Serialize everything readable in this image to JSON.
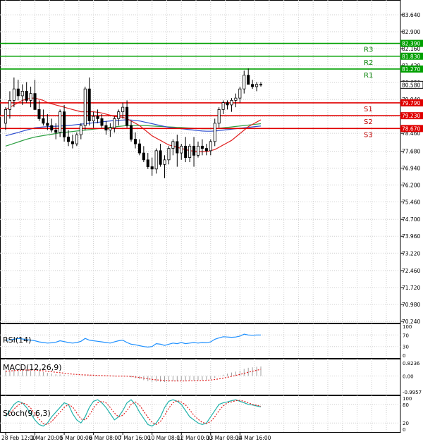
{
  "chart_data": {
    "type": "candlestick",
    "main": {
      "yticks": [
        "83.640",
        "82.900",
        "82.160",
        "81.420",
        "80.680",
        "79.940",
        "79.200",
        "78.460",
        "77.680",
        "76.940",
        "76.200",
        "75.460",
        "74.700",
        "73.960",
        "73.220",
        "72.460",
        "71.720",
        "70.980",
        "70.240"
      ],
      "ylim": [
        70.24,
        83.64
      ],
      "price": 80.58,
      "price_label": "80.580",
      "levels": [
        {
          "name": "R3",
          "value": 82.39,
          "label": "82.390",
          "color": "#00a000"
        },
        {
          "name": "R2",
          "value": 81.83,
          "label": "81.830",
          "color": "#00a000"
        },
        {
          "name": "R1",
          "value": 81.27,
          "label": "81.270",
          "color": "#00a000"
        },
        {
          "name": "S1",
          "value": 79.79,
          "label": "79.790",
          "color": "#e00000"
        },
        {
          "name": "S2",
          "value": 79.23,
          "label": "79.230",
          "color": "#e00000"
        },
        {
          "name": "S3",
          "value": 78.67,
          "label": "78.670",
          "color": "#e00000"
        }
      ],
      "candles": [
        [
          78.9,
          79.6,
          78.6,
          79.5
        ],
        [
          79.5,
          80.3,
          79.1,
          79.9
        ],
        [
          79.9,
          80.9,
          79.6,
          80.4
        ],
        [
          80.4,
          80.8,
          79.9,
          80.1
        ],
        [
          80.1,
          80.6,
          79.7,
          80.3
        ],
        [
          80.3,
          80.7,
          79.8,
          79.9
        ],
        [
          79.9,
          80.5,
          79.6,
          80.2
        ],
        [
          80.2,
          80.8,
          79.7,
          79.5
        ],
        [
          79.5,
          79.9,
          79.0,
          79.1
        ],
        [
          79.1,
          79.5,
          78.8,
          78.9
        ],
        [
          78.9,
          79.3,
          78.6,
          78.8
        ],
        [
          78.8,
          79.1,
          78.5,
          78.6
        ],
        [
          78.6,
          78.9,
          78.2,
          78.5
        ],
        [
          78.5,
          79.5,
          78.3,
          79.4
        ],
        [
          79.4,
          79.7,
          78.1,
          78.3
        ],
        [
          78.3,
          78.6,
          77.9,
          78.1
        ],
        [
          78.1,
          78.4,
          77.8,
          78.0
        ],
        [
          78.0,
          78.5,
          77.9,
          78.4
        ],
        [
          78.4,
          78.9,
          78.2,
          78.8
        ],
        [
          78.8,
          80.5,
          78.6,
          80.4
        ],
        [
          80.4,
          80.9,
          78.8,
          79.0
        ],
        [
          79.0,
          79.4,
          78.7,
          79.2
        ],
        [
          79.2,
          79.5,
          78.9,
          79.1
        ],
        [
          79.1,
          79.3,
          78.7,
          78.8
        ],
        [
          78.8,
          79.0,
          78.4,
          78.6
        ],
        [
          78.6,
          78.9,
          78.3,
          78.7
        ],
        [
          78.7,
          79.2,
          78.5,
          79.1
        ],
        [
          79.1,
          79.5,
          78.8,
          79.4
        ],
        [
          79.4,
          79.8,
          79.1,
          79.6
        ],
        [
          79.6,
          79.9,
          78.7,
          78.8
        ],
        [
          78.8,
          79.0,
          78.1,
          78.2
        ],
        [
          78.2,
          78.5,
          77.8,
          78.0
        ],
        [
          78.0,
          78.2,
          77.5,
          77.6
        ],
        [
          77.6,
          77.9,
          77.2,
          77.3
        ],
        [
          77.3,
          77.6,
          76.9,
          77.0
        ],
        [
          77.0,
          77.4,
          76.6,
          76.9
        ],
        [
          76.9,
          77.8,
          76.7,
          77.7
        ],
        [
          77.7,
          78.0,
          77.0,
          77.1
        ],
        [
          77.1,
          77.5,
          76.5,
          77.3
        ],
        [
          77.3,
          77.9,
          77.1,
          77.8
        ],
        [
          77.8,
          78.2,
          77.5,
          78.1
        ],
        [
          78.1,
          78.4,
          77.0,
          77.6
        ],
        [
          77.6,
          78.0,
          77.3,
          77.9
        ],
        [
          77.9,
          78.3,
          77.2,
          77.4
        ],
        [
          77.4,
          78.0,
          77.2,
          77.9
        ],
        [
          77.9,
          78.3,
          77.0,
          77.5
        ],
        [
          77.5,
          78.1,
          77.4,
          77.9
        ],
        [
          77.9,
          78.2,
          77.5,
          77.8
        ],
        [
          77.8,
          78.0,
          77.5,
          77.7
        ],
        [
          77.7,
          78.2,
          77.5,
          78.1
        ],
        [
          78.1,
          79.1,
          77.9,
          78.9
        ],
        [
          78.9,
          79.6,
          78.7,
          79.5
        ],
        [
          79.5,
          79.9,
          79.3,
          79.8
        ],
        [
          79.8,
          79.9,
          79.5,
          79.7
        ],
        [
          79.7,
          80.0,
          79.4,
          79.9
        ],
        [
          79.9,
          80.2,
          79.6,
          80.0
        ],
        [
          80.0,
          80.5,
          79.8,
          80.4
        ],
        [
          80.4,
          81.2,
          80.2,
          81.0
        ],
        [
          81.0,
          81.3,
          80.6,
          80.6
        ],
        [
          80.6,
          80.8,
          80.4,
          80.5
        ],
        [
          80.5,
          80.7,
          80.3,
          80.6
        ],
        [
          80.6,
          80.7,
          80.5,
          80.58
        ]
      ],
      "ma_red": [
        79.5,
        79.6,
        79.7,
        79.8,
        79.9,
        79.95,
        80.0,
        80.0,
        79.95,
        79.9,
        79.8,
        79.75,
        79.7,
        79.65,
        79.6,
        79.55,
        79.5,
        79.45,
        79.4,
        79.4,
        79.4,
        79.4,
        79.38,
        79.35,
        79.3,
        79.25,
        79.2,
        79.18,
        79.16,
        79.1,
        79.0,
        78.9,
        78.8,
        78.65,
        78.5,
        78.35,
        78.25,
        78.15,
        78.05,
        77.95,
        77.9,
        77.85,
        77.8,
        77.75,
        77.7,
        77.68,
        77.66,
        77.65,
        77.66,
        77.7,
        77.75,
        77.85,
        77.95,
        78.05,
        78.15,
        78.3,
        78.45,
        78.6,
        78.75,
        78.85,
        78.95,
        79.05
      ],
      "ma_blue": [
        78.35,
        78.4,
        78.45,
        78.5,
        78.55,
        78.6,
        78.65,
        78.7,
        78.72,
        78.74,
        78.75,
        78.76,
        78.77,
        78.78,
        78.79,
        78.8,
        78.82,
        78.84,
        78.86,
        78.88,
        78.9,
        78.92,
        78.94,
        78.96,
        78.98,
        79.0,
        79.02,
        79.03,
        79.04,
        79.05,
        79.04,
        79.02,
        79.0,
        78.96,
        78.92,
        78.88,
        78.84,
        78.8,
        78.76,
        78.72,
        78.7,
        78.68,
        78.66,
        78.64,
        78.62,
        78.6,
        78.58,
        78.56,
        78.55,
        78.55,
        78.56,
        78.58,
        78.6,
        78.62,
        78.64,
        78.66,
        78.68,
        78.7,
        78.72,
        78.74,
        78.76,
        78.78
      ],
      "ma_green": [
        77.9,
        77.96,
        78.02,
        78.08,
        78.14,
        78.2,
        78.25,
        78.3,
        78.33,
        78.36,
        78.39,
        78.42,
        78.45,
        78.48,
        78.5,
        78.52,
        78.54,
        78.56,
        78.58,
        78.6,
        78.62,
        78.64,
        78.66,
        78.68,
        78.7,
        78.72,
        78.74,
        78.76,
        78.78,
        78.8,
        78.8,
        78.8,
        78.8,
        78.8,
        78.79,
        78.78,
        78.77,
        78.76,
        78.75,
        78.74,
        78.73,
        78.72,
        78.71,
        78.7,
        78.69,
        78.68,
        78.67,
        78.66,
        78.66,
        78.66,
        78.67,
        78.68,
        78.7,
        78.72,
        78.74,
        78.76,
        78.78,
        78.8,
        78.82,
        78.84,
        78.86,
        78.88
      ]
    },
    "rsi": {
      "label": "RSI(14)",
      "yticks": [
        "100",
        "70",
        "30",
        "0"
      ],
      "levels": [
        100,
        70,
        30,
        0
      ],
      "values": [
        52,
        53,
        55,
        58,
        56,
        54,
        52,
        50,
        46,
        44,
        42,
        43,
        45,
        50,
        47,
        44,
        42,
        44,
        48,
        58,
        52,
        50,
        48,
        46,
        44,
        42,
        46,
        50,
        52,
        44,
        38,
        36,
        33,
        30,
        28,
        30,
        40,
        38,
        34,
        38,
        42,
        40,
        44,
        40,
        42,
        44,
        42,
        44,
        43,
        46,
        55,
        60,
        64,
        63,
        62,
        63,
        66,
        73,
        70,
        69,
        70,
        70
      ]
    },
    "macd": {
      "label": "MACD(12,26,9)",
      "yticks": [
        "0.8236",
        "0.00",
        "-0.9957"
      ],
      "ylim": [
        -0.9957,
        0.8236
      ],
      "hist": [
        0.35,
        0.38,
        0.4,
        0.42,
        0.42,
        0.4,
        0.38,
        0.35,
        0.3,
        0.25,
        0.2,
        0.16,
        0.12,
        0.1,
        0.08,
        0.05,
        0.02,
        0.0,
        0.0,
        0.04,
        0.04,
        0.03,
        0.02,
        0.0,
        -0.02,
        -0.03,
        -0.02,
        0.0,
        0.02,
        -0.02,
        -0.08,
        -0.14,
        -0.2,
        -0.26,
        -0.32,
        -0.36,
        -0.35,
        -0.36,
        -0.38,
        -0.36,
        -0.33,
        -0.33,
        -0.3,
        -0.3,
        -0.28,
        -0.28,
        -0.26,
        -0.25,
        -0.24,
        -0.2,
        -0.12,
        -0.02,
        0.08,
        0.15,
        0.22,
        0.28,
        0.34,
        0.45,
        0.52,
        0.55,
        0.58,
        0.6
      ],
      "signal": [
        0.3,
        0.32,
        0.34,
        0.36,
        0.37,
        0.38,
        0.38,
        0.37,
        0.35,
        0.33,
        0.3,
        0.27,
        0.24,
        0.21,
        0.18,
        0.15,
        0.12,
        0.1,
        0.08,
        0.07,
        0.06,
        0.05,
        0.04,
        0.03,
        0.02,
        0.01,
        0.0,
        0.0,
        0.0,
        -0.01,
        -0.03,
        -0.06,
        -0.09,
        -0.13,
        -0.17,
        -0.21,
        -0.24,
        -0.26,
        -0.28,
        -0.3,
        -0.31,
        -0.31,
        -0.31,
        -0.31,
        -0.3,
        -0.3,
        -0.29,
        -0.28,
        -0.27,
        -0.25,
        -0.22,
        -0.18,
        -0.13,
        -0.08,
        -0.02,
        0.04,
        0.1,
        0.17,
        0.24,
        0.3,
        0.36,
        0.42
      ]
    },
    "stoch": {
      "label": "Stoch(9,6,3)",
      "yticks": [
        "100",
        "80",
        "20",
        "0"
      ],
      "k": [
        40,
        60,
        80,
        90,
        85,
        70,
        50,
        30,
        15,
        10,
        20,
        40,
        55,
        70,
        85,
        80,
        50,
        30,
        20,
        40,
        70,
        90,
        95,
        85,
        70,
        50,
        30,
        40,
        60,
        85,
        95,
        80,
        55,
        35,
        15,
        10,
        20,
        40,
        70,
        90,
        95,
        90,
        80,
        60,
        40,
        30,
        20,
        15,
        20,
        40,
        60,
        80,
        85,
        88,
        92,
        95,
        90,
        85,
        80,
        78,
        75,
        72
      ],
      "d": [
        45,
        50,
        65,
        78,
        85,
        80,
        68,
        50,
        32,
        18,
        15,
        25,
        40,
        55,
        70,
        80,
        72,
        52,
        33,
        30,
        45,
        68,
        85,
        90,
        85,
        70,
        52,
        40,
        45,
        60,
        80,
        88,
        78,
        58,
        38,
        22,
        15,
        25,
        45,
        68,
        85,
        92,
        88,
        78,
        62,
        45,
        32,
        22,
        18,
        25,
        40,
        60,
        75,
        85,
        88,
        92,
        93,
        90,
        85,
        80,
        77,
        74
      ]
    },
    "xlabels": [
      "28 Feb 12:00",
      "1 Mar 20:00",
      "5 Mar 00:00",
      "6 Mar 08:00",
      "7 Mar 16:00",
      "10 Mar 08:01",
      "12 Mar 00:00",
      "13 Mar 08:00",
      "14 Mar 16:00"
    ],
    "xlabel_index": [
      0,
      7,
      14,
      21,
      28,
      35,
      42,
      49,
      56
    ]
  }
}
